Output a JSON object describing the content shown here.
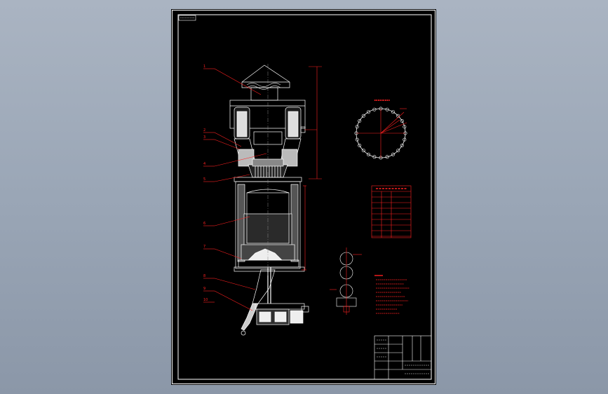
{
  "viewport": {
    "background_color": "#9aa6b6"
  },
  "drawing_sheet": {
    "background_color": "#000000",
    "frame_color": "#ffffff",
    "annotation_color": "#ff2020",
    "title_stamp_text": "",
    "balloon_labels": [
      "1",
      "2",
      "3",
      "4",
      "5",
      "6",
      "7",
      "8",
      "9",
      "10"
    ],
    "circle_view_title": "",
    "table_title": "",
    "notes_title": ""
  }
}
